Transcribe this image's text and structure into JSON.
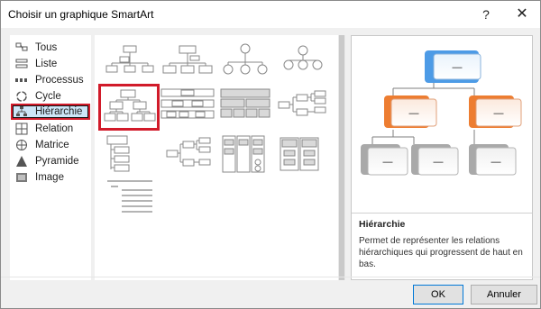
{
  "window": {
    "title": "Choisir un graphique SmartArt",
    "help_label": "?",
    "close_label": "✕"
  },
  "categories": [
    {
      "label": "Tous",
      "icon": "all-icon"
    },
    {
      "label": "Liste",
      "icon": "list-icon"
    },
    {
      "label": "Processus",
      "icon": "process-icon"
    },
    {
      "label": "Cycle",
      "icon": "cycle-icon"
    },
    {
      "label": "Hiérarchie",
      "icon": "hierarchy-icon",
      "selected": true
    },
    {
      "label": "Relation",
      "icon": "relation-icon"
    },
    {
      "label": "Matrice",
      "icon": "matrix-icon"
    },
    {
      "label": "Pyramide",
      "icon": "pyramid-icon"
    },
    {
      "label": "Image",
      "icon": "image-icon"
    }
  ],
  "gallery": {
    "layouts": [
      {
        "name": "organigramme"
      },
      {
        "name": "organigramme-nom-titre"
      },
      {
        "name": "organigramme-circulaire"
      },
      {
        "name": "hierarchie-cercles"
      },
      {
        "name": "hierarchie",
        "selected": true
      },
      {
        "name": "hierarchie-etiquetee"
      },
      {
        "name": "hierarchie-tableau"
      },
      {
        "name": "hierarchie-horizontale"
      },
      {
        "name": "liste-hierarchique"
      },
      {
        "name": "hierarchie-horizontale-etiquetee"
      },
      {
        "name": "hierarchie-multiniveau"
      },
      {
        "name": "liste-colonnes"
      },
      {
        "name": "liste-retrait"
      }
    ]
  },
  "preview": {
    "box_placeholder": "—",
    "title": "Hiérarchie",
    "description": "Permet de représenter les relations hiérarchiques qui progressent de haut en bas.",
    "colors": {
      "top": "#4d9be6",
      "mid": "#ed7d31",
      "bottom": "#a9a9a9"
    }
  },
  "buttons": {
    "ok": "OK",
    "cancel": "Annuler"
  }
}
